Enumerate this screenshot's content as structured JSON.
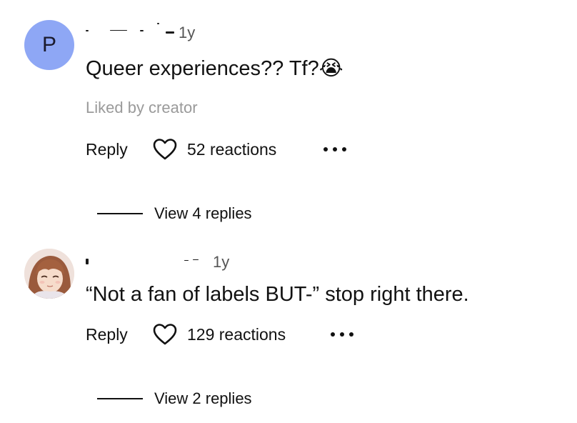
{
  "comments": [
    {
      "avatar_letter": "P",
      "avatar_color": "#8ea7f5",
      "timestamp": "1y",
      "text": "Queer experiences?? Tf?",
      "emoji": "😭",
      "liked_by": "Liked by creator",
      "reply_label": "Reply",
      "reactions_label": "52 reactions",
      "view_replies_label": "View 4 replies"
    },
    {
      "avatar_icon": "anime-girl-avatar",
      "timestamp": "1y",
      "text": "“Not a fan of labels BUT-” stop right there.",
      "reply_label": "Reply",
      "reactions_label": "129 reactions",
      "view_replies_label": "View 2 replies"
    }
  ]
}
